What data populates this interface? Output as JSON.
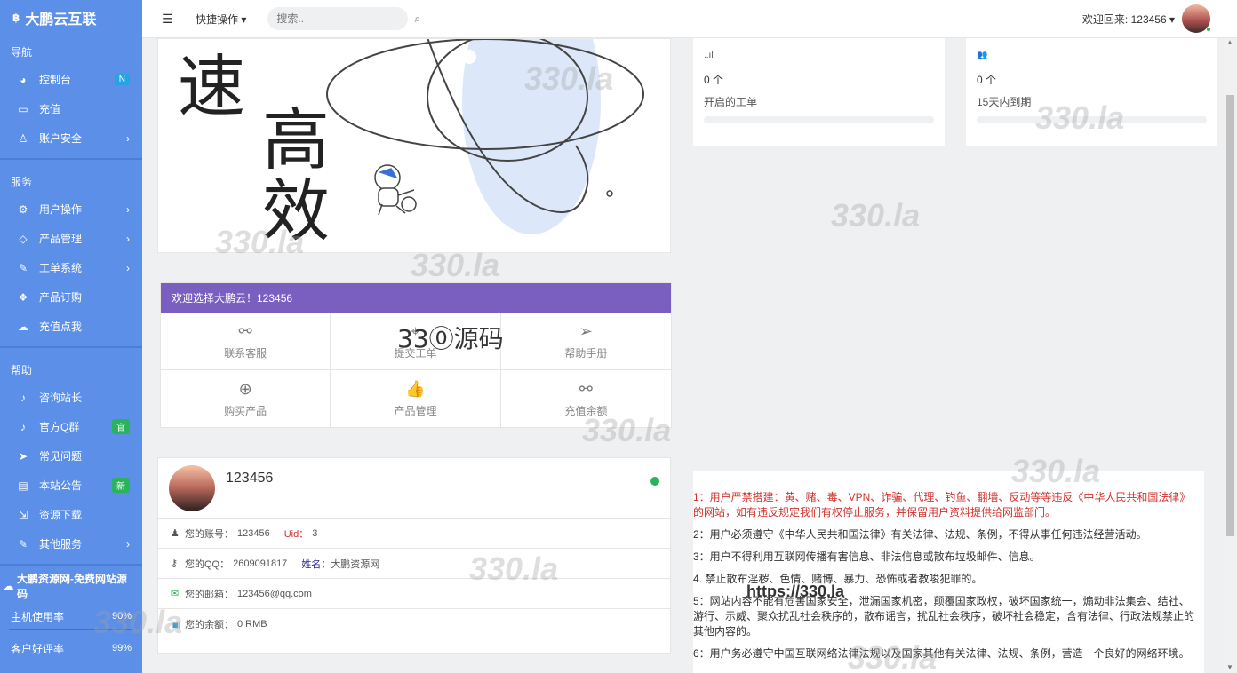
{
  "brand": {
    "logo": "฿",
    "name": "大鹏云互联"
  },
  "sidebar": {
    "sections": [
      {
        "title": "导航",
        "items": [
          {
            "label": "控制台",
            "icon": "dashboard-icon",
            "glyph": "◕",
            "badge": "N",
            "badge_color": "blue"
          },
          {
            "label": "充值",
            "icon": "card-icon",
            "glyph": "▭"
          },
          {
            "label": "账户安全",
            "icon": "user-icon",
            "glyph": "♙",
            "arrow": true
          }
        ]
      },
      {
        "title": "服务",
        "items": [
          {
            "label": "用户操作",
            "icon": "gear-icon",
            "glyph": "⚙",
            "arrow": true
          },
          {
            "label": "产品管理",
            "icon": "diamond-icon",
            "glyph": "◇",
            "arrow": true
          },
          {
            "label": "工单系统",
            "icon": "edit-icon",
            "glyph": "✎",
            "arrow": true
          },
          {
            "label": "产品订购",
            "icon": "layers-icon",
            "glyph": "❖"
          },
          {
            "label": "充值点我",
            "icon": "cloud-upload-icon",
            "glyph": "☁"
          }
        ]
      },
      {
        "title": "帮助",
        "items": [
          {
            "label": "咨询站长",
            "icon": "bell-icon",
            "glyph": "♪"
          },
          {
            "label": "官方Q群",
            "icon": "bell-icon",
            "glyph": "♪",
            "badge": "官",
            "badge_color": "green"
          },
          {
            "label": "常见问题",
            "icon": "send-icon",
            "glyph": "➤"
          },
          {
            "label": "本站公告",
            "icon": "doc-icon",
            "glyph": "▤",
            "badge": "新",
            "badge_color": "green"
          },
          {
            "label": "资源下载",
            "icon": "download-icon",
            "glyph": "⇲"
          },
          {
            "label": "其他服务",
            "icon": "edit-icon",
            "glyph": "✎",
            "arrow": true
          }
        ]
      }
    ],
    "promo": {
      "label": "大鹏资源网-免费网站源码",
      "glyph": "☁"
    },
    "stats": [
      {
        "label": "主机使用率",
        "value": "90%"
      },
      {
        "label": "客户好评率",
        "value": "99%"
      }
    ]
  },
  "topbar": {
    "quick_label": "快捷操作 ▾",
    "search_placeholder": "搜索..",
    "welcome": "欢迎回来: 123456 ▾"
  },
  "hero": {
    "chars": [
      "速",
      "高",
      "效"
    ]
  },
  "stat_cards": [
    {
      "icon": "signal-icon",
      "glyph": "..ıl",
      "count": "0 个",
      "label": "开启的工单"
    },
    {
      "icon": "users-icon",
      "glyph": "👥",
      "count": "0 个",
      "label": "15天内到期"
    }
  ],
  "shortcuts": {
    "title": "欢迎选择大鹏云！123456",
    "items": [
      {
        "label": "联系客服",
        "icon": "link-icon",
        "glyph": "⚯"
      },
      {
        "label": "提交工单",
        "icon": "location-icon",
        "glyph": "⌖"
      },
      {
        "label": "帮助手册",
        "icon": "send-icon",
        "glyph": "➢"
      },
      {
        "label": "购买产品",
        "icon": "plus-circle-icon",
        "glyph": "⊕"
      },
      {
        "label": "产品管理",
        "icon": "thumbs-up-icon",
        "glyph": "👍"
      },
      {
        "label": "充值余额",
        "icon": "link-icon",
        "glyph": "⚯"
      }
    ]
  },
  "profile": {
    "username": "123456",
    "rows": [
      {
        "icon": "user-icon",
        "glyph": "♟",
        "k": "您的账号：",
        "v": "123456",
        "k2": "Uid：",
        "v2": "3",
        "k2_color": "red"
      },
      {
        "icon": "key-icon",
        "glyph": "⚷",
        "k": "您的QQ：",
        "v": "2609091817",
        "k2": "姓名：",
        "v2": "大鹏资源网",
        "k2_color": "navy"
      },
      {
        "icon": "mail-icon",
        "glyph": "✉",
        "k": "您的邮箱：",
        "v": "123456@qq.com"
      },
      {
        "icon": "money-icon",
        "glyph": "▣",
        "k": "您的余额：",
        "v": "0 RMB"
      }
    ]
  },
  "notice": [
    "1：用户严禁搭建：黄、赌、毒、VPN、诈骗、代理、钓鱼、翻墙、反动等等违反《中华人民共和国法律》的网站，如有违反规定我们有权停止服务，并保留用户资料提供给网监部门。",
    "2：用户必须遵守《中华人民共和国法律》有关法律、法规、条例，不得从事任何违法经营活动。",
    "3：用户不得利用互联网传播有害信息、非法信息或散布垃圾邮件、信息。",
    "4. 禁止散布淫秽、色情、赌博、暴力、恐怖或者教唆犯罪的。",
    "5：网站内容不能有危害国家安全，泄漏国家机密，颠覆国家政权，破坏国家统一，煽动非法集会、结社、游行、示威、聚众扰乱社会秩序的，散布谣言，扰乱社会秩序，破坏社会稳定，含有法律、行政法规禁止的其他内容的。",
    "6：用户务必遵守中国互联网络法律法规以及国家其他有关法律、法规、条例，营造一个良好的网络环境。"
  ],
  "watermarks": {
    "text": "330.la",
    "source": "33⓪源码",
    "url": "https://330.la"
  },
  "colors": {
    "sidebar": "#5b8fe8",
    "header_purple": "#7a5fc0",
    "online": "#29b35a",
    "notice_red": "#d0312d"
  }
}
